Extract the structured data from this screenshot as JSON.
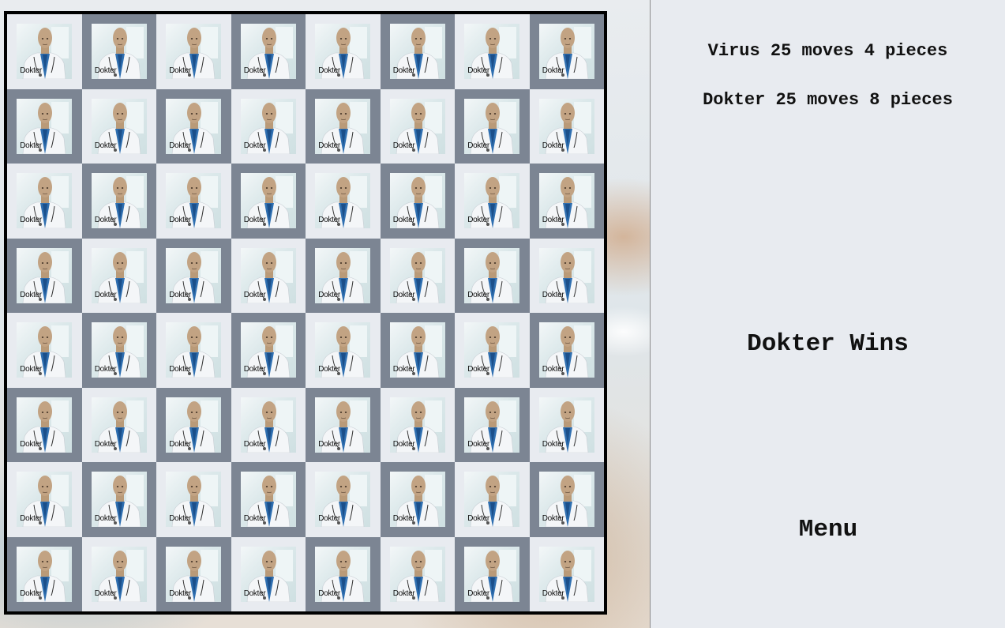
{
  "board": {
    "rows": 8,
    "cols": 8,
    "colors": {
      "light": "#e8ebf0",
      "dark": "#7c8593",
      "border": "#000000"
    },
    "piece": {
      "icon": "dokter-piece-icon",
      "label": "Dokter"
    }
  },
  "panel": {
    "virus_status": "Virus 25 moves 4 pieces",
    "dokter_status": "Dokter 25 moves 8 pieces",
    "result": "Dokter Wins",
    "menu_label": "Menu"
  }
}
